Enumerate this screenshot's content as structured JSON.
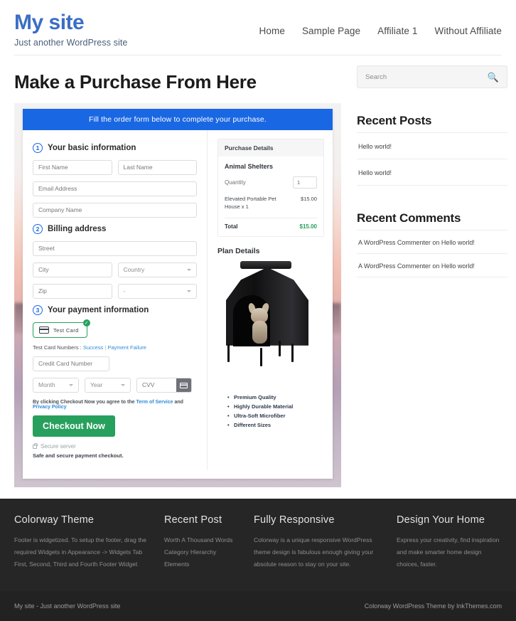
{
  "header": {
    "site_title": "My site",
    "tagline": "Just another WordPress site",
    "nav": [
      {
        "label": "Home"
      },
      {
        "label": "Sample Page"
      },
      {
        "label": "Affiliate 1"
      },
      {
        "label": "Without Affiliate"
      }
    ]
  },
  "main": {
    "page_title": "Make a Purchase From Here",
    "form": {
      "banner": "Fill the order form below to complete your purchase.",
      "steps": [
        {
          "num": "1",
          "label": "Your basic information"
        },
        {
          "num": "2",
          "label": "Billing address"
        },
        {
          "num": "3",
          "label": "Your payment information"
        }
      ],
      "fields": {
        "first_name": "First Name",
        "last_name": "Last Name",
        "email": "Email Address",
        "company": "Company Name",
        "street": "Street",
        "city": "City",
        "country": "Country",
        "zip": "Zip",
        "state": "-",
        "credit_card_number": "Credit Card Number",
        "month": "Month",
        "year": "Year",
        "cvv": "CVV"
      },
      "payment_method": {
        "label": "Test Card",
        "icon": "credit-card-icon",
        "selected_badge": "✓"
      },
      "test_card_line": {
        "prefix": "Test Card Numbers :",
        "success": "Success",
        "separator": "|",
        "failure": "Payment Failure"
      },
      "agreement": {
        "prefix": "By clicking Checkout Now you agree to the",
        "terms": "Term of Service",
        "and": "and",
        "privacy": "Privacy Policy"
      },
      "checkout_label": "Checkout Now",
      "secure_server": "Secure server",
      "safe_note": "Safe and secure payment checkout."
    },
    "purchase_details": {
      "heading": "Purchase Details",
      "product_group": "Animal Shelters",
      "quantity_label": "Quantity",
      "quantity_value": "1",
      "line_item_name": "Elevated Portable Pet House x 1",
      "line_item_price": "$15.00",
      "total_label": "Total",
      "total_value": "$15.00"
    },
    "plan_details": {
      "heading": "Plan Details",
      "image_alt": "elevated-portable-pet-house-photo",
      "features": [
        "Premium Quality",
        "Highly Durable Material",
        "Ultra-Soft Microfiber",
        "Different Sizes"
      ]
    }
  },
  "sidebar": {
    "search": {
      "placeholder": "Search",
      "icon": "search-icon",
      "glyph": "🔍"
    },
    "recent_posts": {
      "title": "Recent Posts",
      "items": [
        {
          "label": "Hello world!"
        },
        {
          "label": "Hello world!"
        }
      ]
    },
    "recent_comments": {
      "title": "Recent Comments",
      "items": [
        {
          "label": "A WordPress Commenter on Hello world!"
        },
        {
          "label": "A WordPress Commenter on Hello world!"
        }
      ]
    }
  },
  "footer": {
    "columns": [
      {
        "title": "Colorway Theme",
        "text": "Footer is widgetized. To setup the footer, drag the required Widgets in Appearance -> Widgets Tab First, Second, Third and Fourth Footer Widget"
      },
      {
        "title": "Recent Post",
        "links": [
          {
            "label": "Worth A Thousand Words"
          },
          {
            "label": "Category Hierarchy"
          },
          {
            "label": "Elements"
          }
        ]
      },
      {
        "title": "Fully Responsive",
        "text": "Colorway is a unique responsive WordPress theme design is fabulous enough giving your absolute reason to stay on your site."
      },
      {
        "title": "Design Your Home",
        "text": "Express your creativity, find inspiration and make smarter home design choices, faster."
      }
    ],
    "bar_left": "My site - Just another WordPress site",
    "bar_right": "Colorway WordPress Theme by InkThemes.com"
  },
  "colors": {
    "brand_blue": "#3b6fc4",
    "banner_blue": "#1a67e3",
    "accent_green": "#27a05d",
    "link_blue": "#2d8cd8",
    "footer_bg": "#262626"
  }
}
